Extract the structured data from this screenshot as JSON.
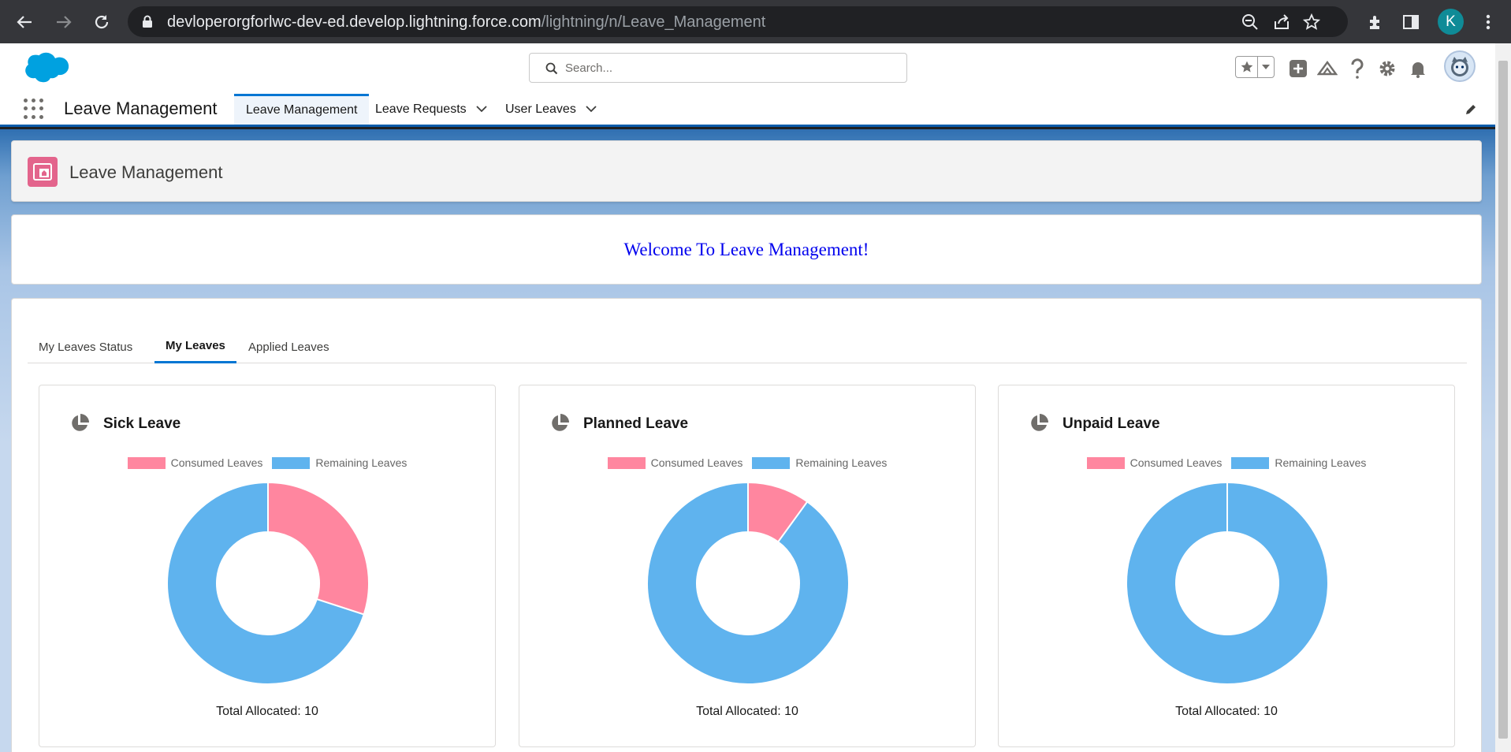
{
  "browser": {
    "url_host": "devloperorgforlwc-dev-ed.develop.lightning.force.com",
    "url_path": "/lightning/n/Leave_Management",
    "profile_initial": "K",
    "icons": [
      "back-icon",
      "forward-icon",
      "reload-icon",
      "lock-icon",
      "zoom-out-icon",
      "share-icon",
      "bookmark-star-icon",
      "extensions-icon",
      "side-panel-icon",
      "menu-icon"
    ]
  },
  "header": {
    "search_placeholder": "Search...",
    "icons": [
      "salesforce-logo",
      "favorites-star-icon",
      "global-actions-plus-icon",
      "trailhead-icon",
      "help-icon",
      "setup-gear-icon",
      "notifications-bell-icon",
      "user-avatar"
    ]
  },
  "nav": {
    "app_name": "Leave Management",
    "items": [
      {
        "label": "Leave Management"
      },
      {
        "label": "Leave Requests"
      },
      {
        "label": "User Leaves"
      }
    ]
  },
  "page": {
    "title": "Leave Management",
    "welcome": "Welcome To Leave Management!"
  },
  "tabs": [
    {
      "label": "My Leaves Status"
    },
    {
      "label": "My Leaves"
    },
    {
      "label": "Applied Leaves"
    }
  ],
  "colors": {
    "consumed": "#ff869f",
    "remaining": "#5fb3ee",
    "accent": "#0176d3"
  },
  "legend": {
    "consumed": "Consumed Leaves",
    "remaining": "Remaining Leaves"
  },
  "chart_data": [
    {
      "type": "pie",
      "title": "Sick Leave",
      "categories": [
        "Consumed Leaves",
        "Remaining Leaves"
      ],
      "values": [
        3,
        7
      ],
      "footer": "Total Allocated: 10"
    },
    {
      "type": "pie",
      "title": "Planned Leave",
      "categories": [
        "Consumed Leaves",
        "Remaining Leaves"
      ],
      "values": [
        1,
        9
      ],
      "footer": "Total Allocated: 10"
    },
    {
      "type": "pie",
      "title": "Unpaid Leave",
      "categories": [
        "Consumed Leaves",
        "Remaining Leaves"
      ],
      "values": [
        0,
        10
      ],
      "footer": "Total Allocated: 10"
    }
  ]
}
